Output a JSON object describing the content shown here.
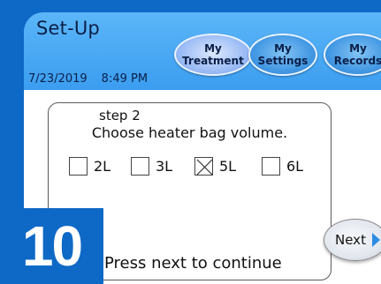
{
  "header": {
    "title": "Set-Up",
    "date": "7/23/2019",
    "time": "8:49 PM"
  },
  "nav": [
    {
      "line1": "My",
      "line2": "Treatment",
      "active": true,
      "icon": "treatment-button"
    },
    {
      "line1": "My",
      "line2": "Settings",
      "active": false,
      "icon": "settings-button"
    },
    {
      "line1": "My",
      "line2": "Records",
      "active": false,
      "icon": "records-button"
    }
  ],
  "step": {
    "label": "step 2",
    "prompt": "Choose heater bag volume.",
    "options": [
      {
        "label": "2L",
        "checked": false
      },
      {
        "label": "3L",
        "checked": false
      },
      {
        "label": "5L",
        "checked": true
      },
      {
        "label": "6L",
        "checked": false
      }
    ]
  },
  "status_text": "Press next to continue",
  "next_button": {
    "label": "Next",
    "icon": "right-arrow-icon"
  },
  "badge": {
    "number": "10"
  },
  "colors": {
    "screen_blue": "#2d8ee8",
    "badge_blue": "#0e69c6",
    "text_dark": "#0b1f47",
    "active_button": "#9cbcf5"
  }
}
